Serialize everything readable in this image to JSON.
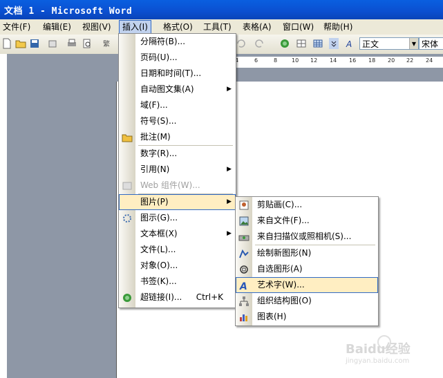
{
  "window": {
    "title": "文档 1 - Microsoft Word"
  },
  "menubar": [
    {
      "label": "文件(F)"
    },
    {
      "label": "编辑(E)"
    },
    {
      "label": "视图(V)"
    },
    {
      "label": "插入(I)"
    },
    {
      "label": "格式(O)"
    },
    {
      "label": "工具(T)"
    },
    {
      "label": "表格(A)"
    },
    {
      "label": "窗口(W)"
    },
    {
      "label": "帮助(H)"
    }
  ],
  "toolbar": {
    "style_value": "正文",
    "font_value": "宋体"
  },
  "ruler_ticks": [
    "4",
    "6",
    "8",
    "10",
    "12",
    "14",
    "16",
    "18",
    "20",
    "22",
    "24"
  ],
  "insert_menu": [
    {
      "label": "分隔符(B)..."
    },
    {
      "label": "页码(U)..."
    },
    {
      "label": "日期和时间(T)..."
    },
    {
      "label": "自动图文集(A)"
    },
    {
      "label": "域(F)..."
    },
    {
      "label": "符号(S)..."
    },
    {
      "label": "批注(M)"
    },
    {
      "label": "数字(R)..."
    },
    {
      "label": "引用(N)"
    },
    {
      "label": "Web 组件(W)..."
    },
    {
      "label": "图片(P)"
    },
    {
      "label": "图示(G)..."
    },
    {
      "label": "文本框(X)"
    },
    {
      "label": "文件(L)..."
    },
    {
      "label": "对象(O)..."
    },
    {
      "label": "书签(K)..."
    },
    {
      "label": "超链接(I)...",
      "shortcut": "Ctrl+K"
    }
  ],
  "picture_menu": [
    {
      "label": "剪贴画(C)..."
    },
    {
      "label": "来自文件(F)..."
    },
    {
      "label": "来自扫描仪或照相机(S)..."
    },
    {
      "label": "绘制新图形(N)"
    },
    {
      "label": "自选图形(A)"
    },
    {
      "label": "艺术字(W)..."
    },
    {
      "label": "组织结构图(O)"
    },
    {
      "label": "图表(H)"
    }
  ],
  "watermark": {
    "text": "Baidu经验",
    "sub": "jingyan.baidu.com"
  }
}
